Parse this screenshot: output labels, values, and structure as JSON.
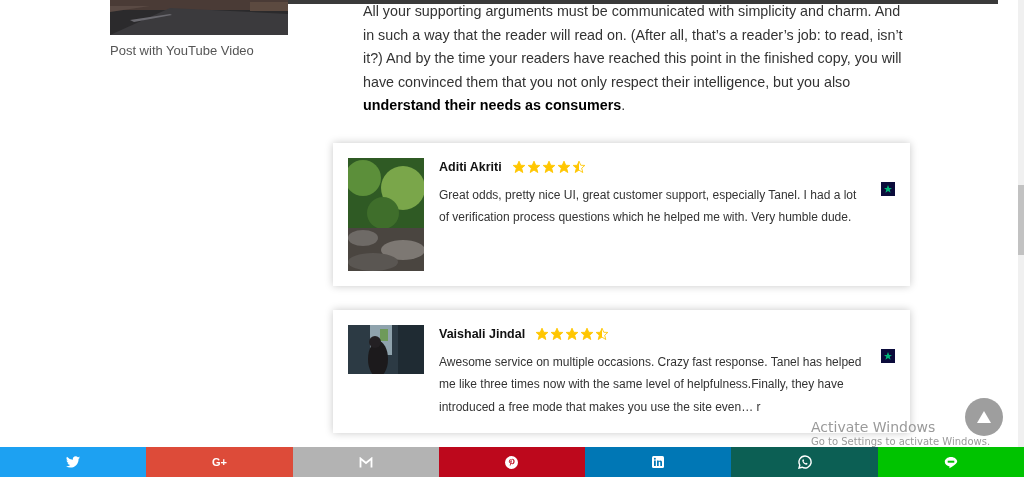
{
  "sidebar": {
    "post_caption": "Post with YouTube Video"
  },
  "article": {
    "paragraph": "All your supporting arguments must be communicated with simplicity and charm. And in such a way that the reader will read on. (After all, that’s a reader’s job: to read, isn’t it?) And by the time your readers have reached this point in the finished copy, you will have convinced them that you not only respect their intelligence, but you also **understand their needs as consumers**."
  },
  "reviews": [
    {
      "name": "Aditi Akriti",
      "stars": 4.5,
      "text": "Great odds, pretty nice UI, great customer support, especially Tanel. I had a lot of verification process questions which he helped me with. Very humble dude."
    },
    {
      "name": "Vaishali Jindal",
      "stars": 4.5,
      "text": "Awesome service on multiple occasions. Crazy fast response. Tanel has helped me like three times now with the same level of helpfulness.Finally, they have introduced a free mode that makes you use the site even… r"
    }
  ],
  "windows_notice": {
    "title": "Activate Windows",
    "subtitle": "Go to Settings to activate Windows."
  },
  "share_bar": [
    {
      "kind": "twitter",
      "color": "#1da1f2"
    },
    {
      "kind": "google-plus",
      "label": "G+",
      "color": "#dd4b39"
    },
    {
      "kind": "gmail",
      "color": "#b3b3b3"
    },
    {
      "kind": "pinterest",
      "color": "#bd081c"
    },
    {
      "kind": "linkedin",
      "color": "#0077b5"
    },
    {
      "kind": "whatsapp",
      "color": "#0c5f54"
    },
    {
      "kind": "line",
      "color": "#00c300"
    }
  ]
}
